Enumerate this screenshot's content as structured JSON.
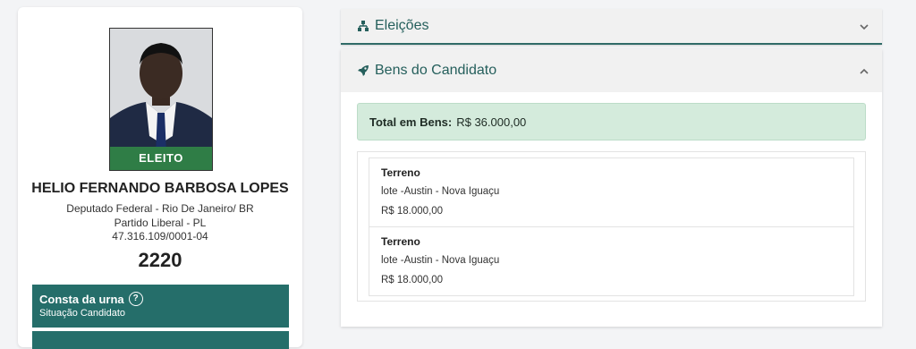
{
  "candidate": {
    "status_badge": "ELEITO",
    "name": "HELIO FERNANDO BARBOSA LOPES",
    "office_line": "Deputado Federal - Rio De Janeiro/ BR",
    "party_line": "Partido Liberal - PL",
    "id_line": "47.316.109/0001-04",
    "number": "2220"
  },
  "urn": {
    "title": "Consta da urna",
    "subtitle": "Situação Candidato",
    "help_icon": "question-circle-icon"
  },
  "sections": {
    "elections": {
      "title": "Eleições",
      "icon": "sitemap-icon",
      "expanded": false
    },
    "assets": {
      "title": "Bens do Candidato",
      "icon": "rocket-icon",
      "expanded": true
    }
  },
  "assets": {
    "total_label": "Total em Bens:",
    "total_value": "R$ 36.000,00",
    "items": [
      {
        "type": "Terreno",
        "description": "lote -Austin - Nova Iguaçu",
        "value": "R$ 18.000,00"
      },
      {
        "type": "Terreno",
        "description": "lote -Austin - Nova Iguaçu",
        "value": "R$ 18.000,00"
      }
    ]
  },
  "colors": {
    "accent": "#256e6a",
    "elected": "#2f7d46",
    "total_bg": "#d4ebdc"
  }
}
